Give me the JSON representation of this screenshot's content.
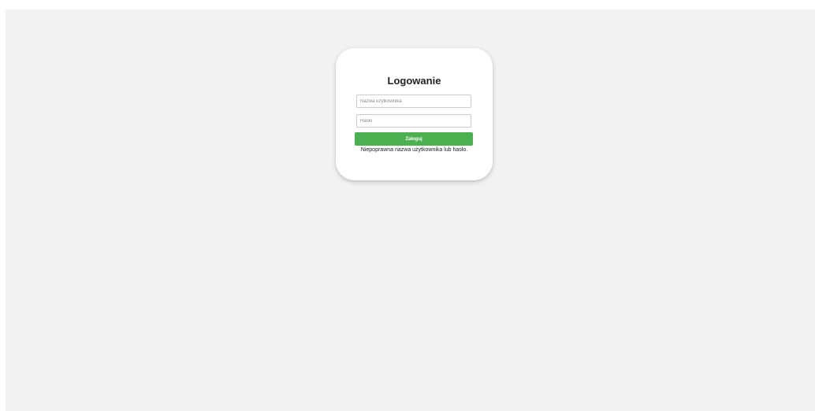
{
  "login": {
    "title": "Logowanie",
    "username_placeholder": "Nazwa użytkownika",
    "password_placeholder": "Hasło",
    "submit_label": "Zaloguj",
    "error_message": "Niepoprawna nazwa użytkownika lub hasło."
  },
  "colors": {
    "background": "#f2f2f2",
    "card": "#ffffff",
    "accent": "#4caf50"
  }
}
